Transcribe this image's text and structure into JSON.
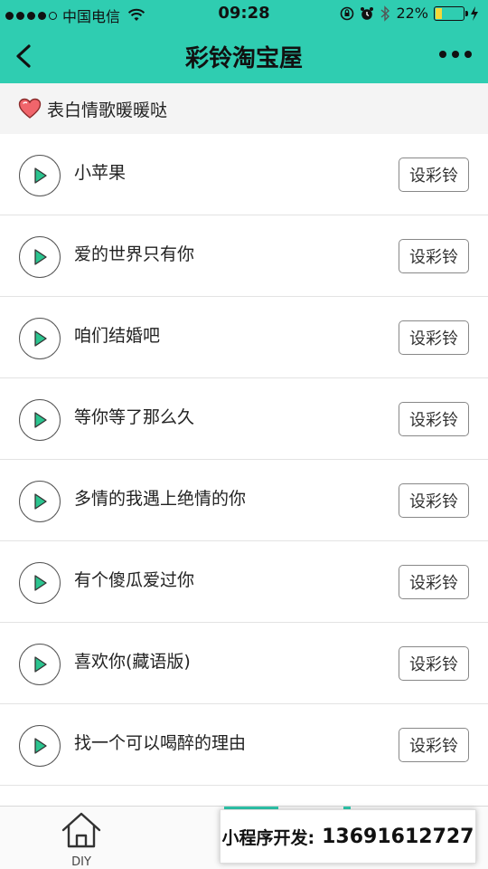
{
  "status_bar": {
    "carrier": "中国电信",
    "time": "09:28",
    "battery": "22%",
    "battery_level": 0.22
  },
  "nav": {
    "title": "彩铃淘宝屋"
  },
  "section": {
    "title": "表白情歌暖暖哒"
  },
  "songs": [
    {
      "title": "小苹果",
      "action": "设彩铃"
    },
    {
      "title": "爱的世界只有你",
      "action": "设彩铃"
    },
    {
      "title": "咱们结婚吧",
      "action": "设彩铃"
    },
    {
      "title": "等你等了那么久",
      "action": "设彩铃"
    },
    {
      "title": "多情的我遇上绝情的你",
      "action": "设彩铃"
    },
    {
      "title": "有个傻瓜爱过你",
      "action": "设彩铃"
    },
    {
      "title": "喜欢你(藏语版)",
      "action": "设彩铃"
    },
    {
      "title": "找一个可以喝醉的理由",
      "action": "设彩铃"
    }
  ],
  "tabbar": {
    "diy_label": "DIY"
  },
  "promo": {
    "label": "小程序开发:",
    "phone": "13691612727"
  },
  "colors": {
    "accent": "#2fcdb1",
    "play_icon": "#2bc48f",
    "heart": "#f0656b"
  }
}
